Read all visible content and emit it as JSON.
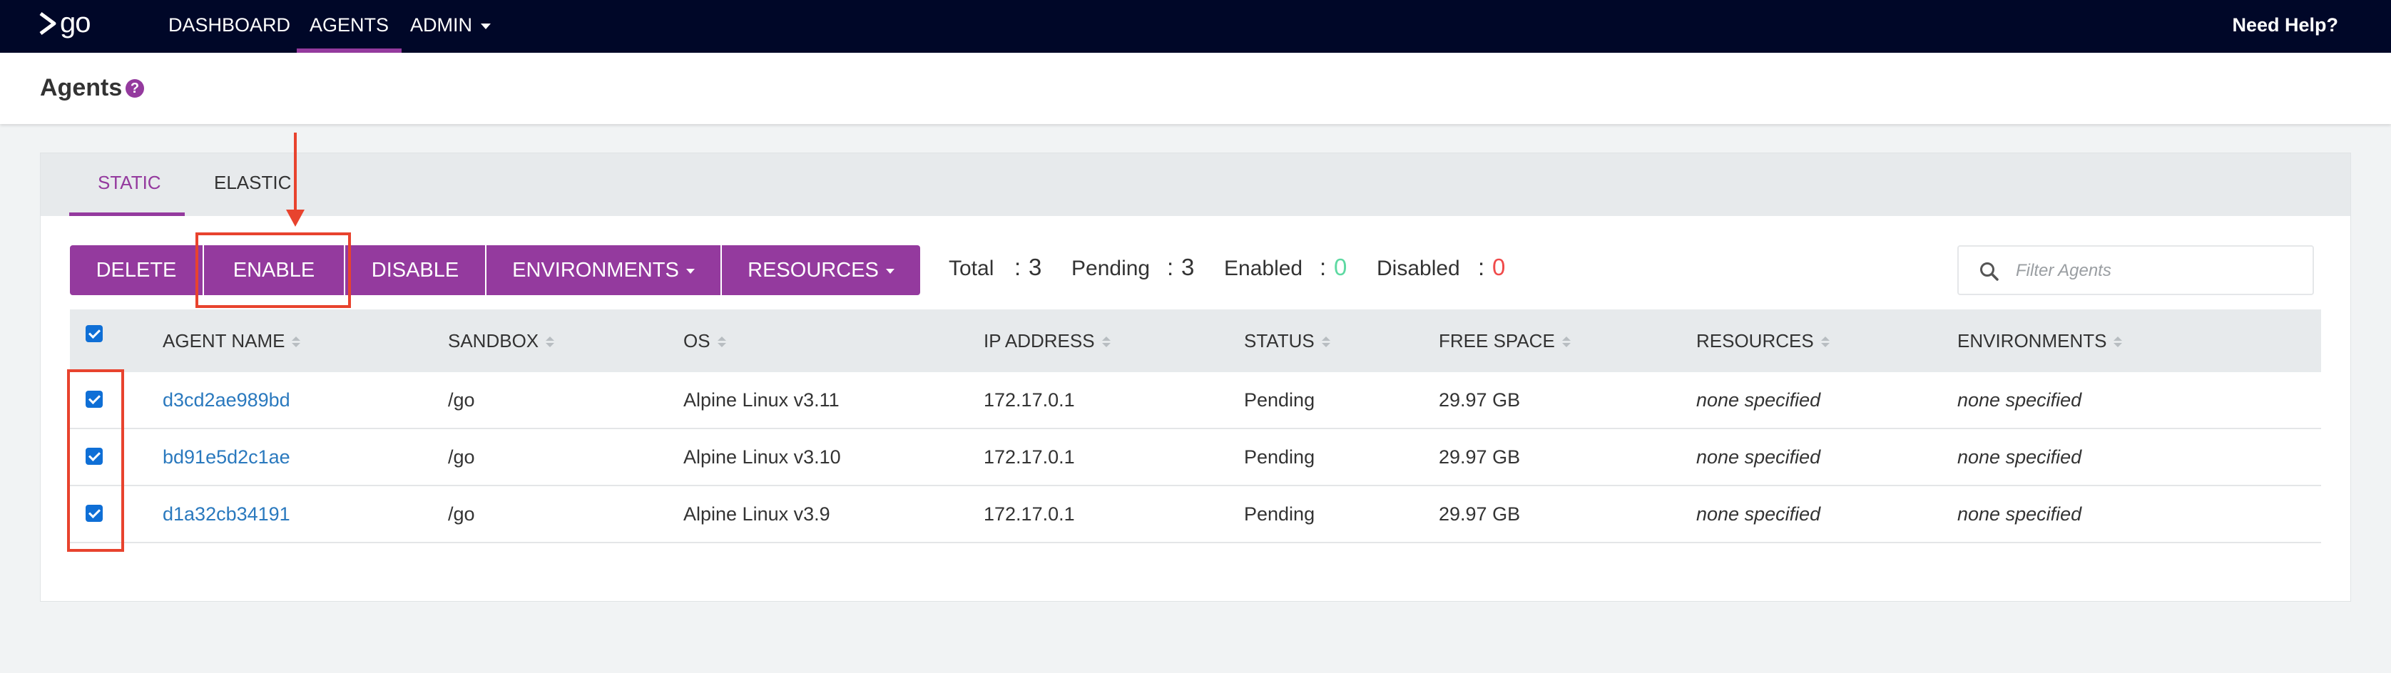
{
  "nav": {
    "logo_text": "go",
    "items": [
      {
        "label": "DASHBOARD"
      },
      {
        "label": "AGENTS"
      },
      {
        "label": "ADMIN"
      }
    ],
    "help": "Need Help?"
  },
  "page": {
    "title": "Agents",
    "help_icon_glyph": "?"
  },
  "tabs": [
    {
      "label": "STATIC"
    },
    {
      "label": "ELASTIC"
    }
  ],
  "actions": {
    "delete": "DELETE",
    "enable": "ENABLE",
    "disable": "DISABLE",
    "environments": "ENVIRONMENTS",
    "resources": "RESOURCES"
  },
  "stats": {
    "total_label": "Total",
    "total_value": "3",
    "pending_label": "Pending",
    "pending_value": "3",
    "enabled_label": "Enabled",
    "enabled_value": "0",
    "disabled_label": "Disabled",
    "disabled_value": "0",
    "separator": ":"
  },
  "filter": {
    "placeholder": "Filter Agents"
  },
  "table": {
    "columns": [
      "AGENT NAME",
      "SANDBOX",
      "OS",
      "IP ADDRESS",
      "STATUS",
      "FREE SPACE",
      "RESOURCES",
      "ENVIRONMENTS"
    ],
    "rows": [
      {
        "name": "d3cd2ae989bd",
        "sandbox": "/go",
        "os": "Alpine Linux v3.11",
        "ip": "172.17.0.1",
        "status": "Pending",
        "free_space": "29.97 GB",
        "resources": "none specified",
        "environments": "none specified",
        "checked": true
      },
      {
        "name": "bd91e5d2c1ae",
        "sandbox": "/go",
        "os": "Alpine Linux v3.10",
        "ip": "172.17.0.1",
        "status": "Pending",
        "free_space": "29.97 GB",
        "resources": "none specified",
        "environments": "none specified",
        "checked": true
      },
      {
        "name": "d1a32cb34191",
        "sandbox": "/go",
        "os": "Alpine Linux v3.9",
        "ip": "172.17.0.1",
        "status": "Pending",
        "free_space": "29.97 GB",
        "resources": "none specified",
        "environments": "none specified",
        "checked": true
      }
    ]
  },
  "colors": {
    "nav_bg": "#000728",
    "accent": "#943a9e",
    "link": "#2a79be",
    "enabled_value": "#5ed9a2",
    "disabled_value": "#f04a4a",
    "annotation": "#e8432e"
  }
}
